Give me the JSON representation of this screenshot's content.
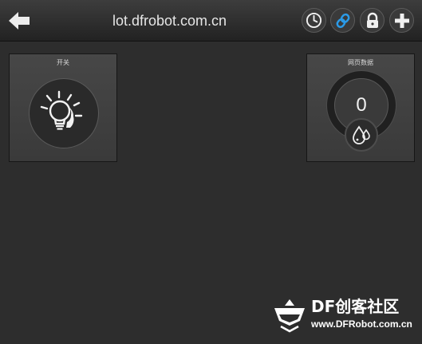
{
  "topbar": {
    "title": "lot.dfrobot.com.cn",
    "back_icon": "arrow-left-icon",
    "buttons": [
      {
        "icon": "clock-icon"
      },
      {
        "icon": "link-icon"
      },
      {
        "icon": "lock-icon"
      },
      {
        "icon": "plus-icon"
      }
    ]
  },
  "widgets": {
    "switch": {
      "label": "开关",
      "icon": "light-bulb-icon"
    },
    "web_data": {
      "label": "网页数据",
      "value": "0",
      "icon": "water-drops-icon"
    }
  },
  "watermark": {
    "title": "DF创客社区",
    "url": "www.DFRobot.com.cn"
  },
  "colors": {
    "background": "#2d2d2d",
    "accent": "#2b9be8"
  }
}
